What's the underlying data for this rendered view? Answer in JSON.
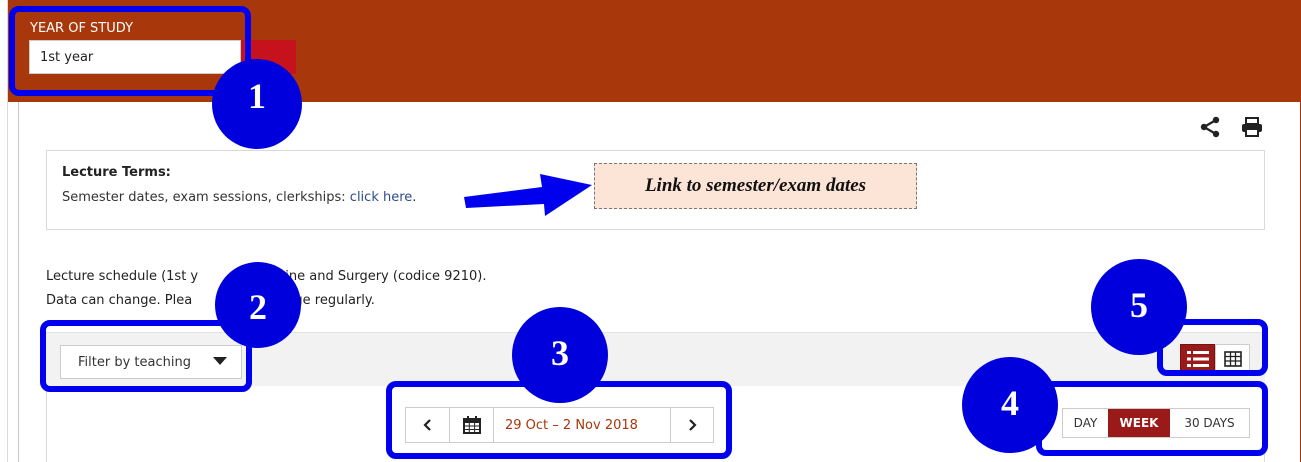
{
  "header": {
    "year_label": "YEAR OF STUDY",
    "year_value": "1st year"
  },
  "icons": {
    "share": "share-icon",
    "print": "print-icon",
    "calendar": "calendar-icon",
    "list_view": "list-view-icon",
    "grid_view": "grid-view-icon"
  },
  "terms": {
    "title": "Lecture Terms:",
    "text_prefix": "Semester dates, exam sessions, clerkships: ",
    "link": "click here",
    "text_suffix": "."
  },
  "callout": {
    "text": "Link to semester/exam dates"
  },
  "schedule": {
    "line1_a": "Lecture schedule (1st y",
    "line1_b": "cine and Surgery (codice 9210).",
    "line2_a": "Data can change. Plea",
    "line2_b": "page regularly."
  },
  "filter": {
    "label": "Filter by teaching"
  },
  "navigation": {
    "prev": "‹",
    "next": "›",
    "date_range": "29 Oct – 2 Nov 2018"
  },
  "range": {
    "day": "DAY",
    "week": "WEEK",
    "thirty_days": "30 DAYS",
    "selected": "WEEK"
  },
  "view": {
    "selected": "list"
  },
  "annotations": [
    "1",
    "2",
    "3",
    "4",
    "5"
  ],
  "colors": {
    "brand": "#a8370b",
    "accent": "#9a1a1a",
    "annotation": "#0000dd",
    "callout_bg": "#fce4d6"
  }
}
